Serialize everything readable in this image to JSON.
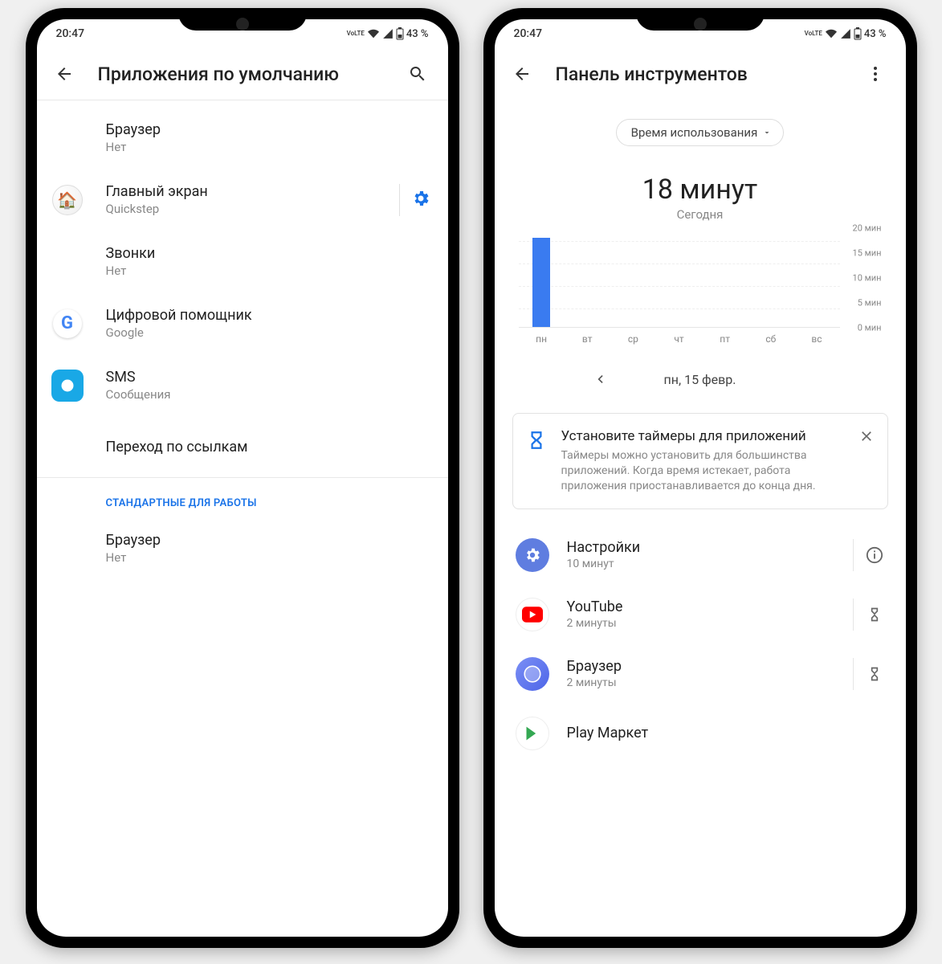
{
  "status": {
    "time": "20:47",
    "battery": "43 %",
    "volte": "VoLTE"
  },
  "phone1": {
    "title": "Приложения по умолчанию",
    "items": [
      {
        "label": "Браузер",
        "value": "Нет",
        "icon": ""
      },
      {
        "label": "Главный экран",
        "value": "Quickstep",
        "icon": "home",
        "gear": true
      },
      {
        "label": "Звонки",
        "value": "Нет",
        "icon": ""
      },
      {
        "label": "Цифровой помощник",
        "value": "Google",
        "icon": "google"
      },
      {
        "label": "SMS",
        "value": "Сообщения",
        "icon": "sms"
      },
      {
        "label": "Переход по ссылкам",
        "value": "",
        "icon": ""
      }
    ],
    "section": "СТАНДАРТНЫЕ ДЛЯ РАБОТЫ",
    "workItems": [
      {
        "label": "Браузер",
        "value": "Нет"
      }
    ]
  },
  "phone2": {
    "title": "Панель инструментов",
    "dropdown": "Время использования",
    "bigValue": "18 минут",
    "bigSub": "Сегодня",
    "date": "пн, 15 февр.",
    "card": {
      "title": "Установите таймеры для приложений",
      "text": "Таймеры можно установить для большинства приложений. Когда время истекает, работа приложения приостанавливается до конца дня."
    },
    "apps": [
      {
        "name": "Настройки",
        "time": "10 минут",
        "icon": "settings",
        "action": "info"
      },
      {
        "name": "YouTube",
        "time": "2 минуты",
        "icon": "youtube",
        "action": "hourglass"
      },
      {
        "name": "Браузер",
        "time": "2 минуты",
        "icon": "browser",
        "action": "hourglass"
      },
      {
        "name": "Play Маркет",
        "time": "",
        "icon": "play",
        "action": ""
      }
    ]
  },
  "chart_data": {
    "type": "bar",
    "title": "Время использования — Сегодня (18 минут)",
    "categories": [
      "пн",
      "вт",
      "ср",
      "чт",
      "пт",
      "сб",
      "вс"
    ],
    "values": [
      18,
      0,
      0,
      0,
      0,
      0,
      0
    ],
    "ylabel": "мин",
    "ylim": [
      0,
      20
    ],
    "yticks": [
      "0 мин",
      "5 мин",
      "10 мин",
      "15 мин",
      "20 мин"
    ]
  }
}
